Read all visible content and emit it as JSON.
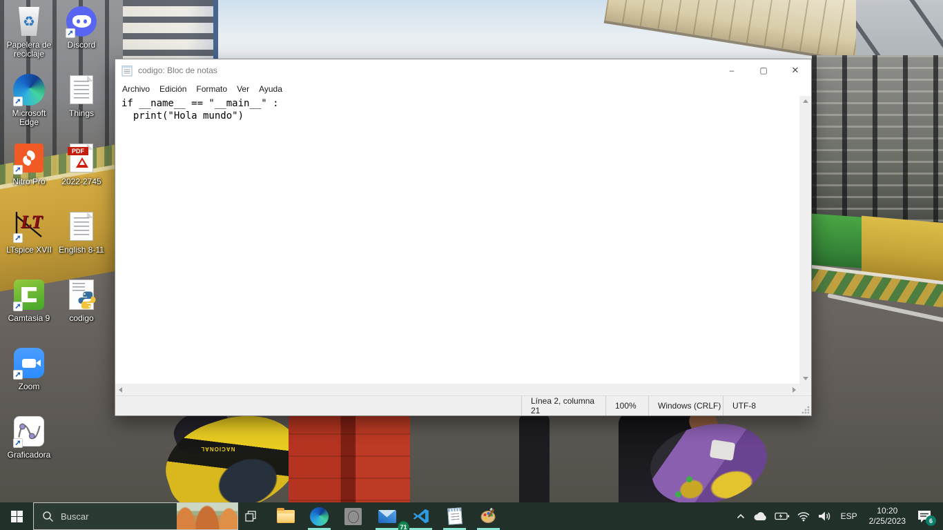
{
  "wallpaper": {
    "description": "F1 racetrack photo: grandstands, green and yellow track walls, two drivers carrying helmets",
    "helmet_text": "NACIONAL"
  },
  "desktop": {
    "icons": [
      {
        "label": "Papelera de reciclaje"
      },
      {
        "label": "Discord"
      },
      {
        "label": "Microsoft Edge"
      },
      {
        "label": "Things"
      },
      {
        "label": "Nitro Pro"
      },
      {
        "label": "2022-2745"
      },
      {
        "label": "LTspice XVII"
      },
      {
        "label": "English 8-11"
      },
      {
        "label": "Camtasia 9"
      },
      {
        "label": "codigo"
      },
      {
        "label": "Zoom"
      },
      {
        "label": "Graficadora"
      }
    ],
    "icon_texts": {
      "pdf": "PDF",
      "ltspice": "LT"
    }
  },
  "notepad": {
    "title": "codigo: Bloc de notas",
    "menu": [
      "Archivo",
      "Edición",
      "Formato",
      "Ver",
      "Ayuda"
    ],
    "lines": [
      "if __name__ == \"__main__\" :",
      "  print(\"Hola mundo\")"
    ],
    "controls": {
      "minimize": "–",
      "maximize": "▢",
      "close": "✕"
    },
    "status": {
      "line_col": "Línea 2, columna 21",
      "zoom_level": "100%",
      "line_ending": "Windows (CRLF)",
      "encoding": "UTF-8"
    }
  },
  "taskbar": {
    "search_placeholder": "Buscar",
    "mail_badge": "71",
    "tray": {
      "language": "ESP",
      "time": "10:20",
      "date": "2/25/2023",
      "notification_count": "6"
    }
  }
}
